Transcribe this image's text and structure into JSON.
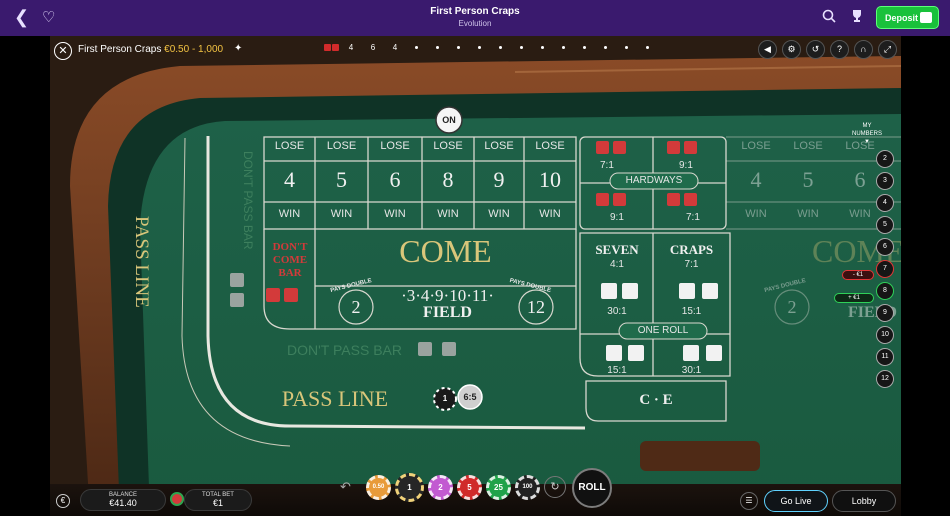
{
  "app": {
    "title": "First Person Craps",
    "provider": "Evolution",
    "deposit_label": "Deposit"
  },
  "hud": {
    "game_title": "First Person Craps",
    "limits": "€0.50 - 1,000",
    "history_numbers": [
      "4",
      "6",
      "4"
    ]
  },
  "table": {
    "on_puck": "ON",
    "lose_labels": [
      "LOSE",
      "LOSE",
      "LOSE",
      "LOSE",
      "LOSE",
      "LOSE"
    ],
    "place_numbers": [
      "4",
      "5",
      "6",
      "8",
      "9",
      "10"
    ],
    "win_labels": [
      "WIN",
      "WIN",
      "WIN",
      "WIN",
      "WIN",
      "WIN"
    ],
    "pass_line_vertical": "PASS LINE",
    "dont_pass_bar_vertical": "DON'T PASS BAR",
    "dont_come_bar": [
      "DON'T",
      "COME",
      "BAR"
    ],
    "come": "COME",
    "field_pays_double_left": "PAYS DOUBLE",
    "field_pays_double_right": "PAYS DOUBLE",
    "field_two": "2",
    "field_twelve": "12",
    "field_numbers": "·3·4·9·10·11·",
    "field": "FIELD",
    "dont_pass_bar": "DON'T PASS BAR",
    "pass_line": "PASS LINE",
    "hardways_label": "HARDWAYS",
    "hardway_odds": [
      "7:1",
      "9:1",
      "9:1",
      "7:1"
    ],
    "seven": "SEVEN",
    "seven_odds": "4:1",
    "craps": "CRAPS",
    "craps_odds": "7:1",
    "one_roll_left_odds": "30:1",
    "one_roll_right_odds": "15:1",
    "one_roll": "ONE ROLL",
    "bottom_left_odds": "15:1",
    "bottom_right_odds": "30:1",
    "ce": "C · E",
    "pass_chip": "1",
    "pass_odds_chip": "6:5",
    "ghost_lose_labels": [
      "LOSE",
      "LOSE",
      "LOSE"
    ],
    "ghost_numbers": [
      "4",
      "5",
      "6"
    ],
    "ghost_win_labels": [
      "WIN",
      "WIN",
      "WIN"
    ],
    "ghost_come": "COME",
    "ghost_pays_double": "PAYS DOUBLE",
    "ghost_two": "2",
    "ghost_field": "FIELD"
  },
  "my_numbers": {
    "title_line1": "MY",
    "title_line2": "NUMBERS",
    "numbers": [
      "2",
      "3",
      "4",
      "5",
      "6",
      "7",
      "8",
      "9",
      "10",
      "11",
      "12"
    ],
    "red_tag": "- €1",
    "green_tag": "+ €1"
  },
  "bottom": {
    "balance_label": "BALANCE",
    "balance_value": "€41.40",
    "total_bet_label": "TOTAL BET",
    "total_bet_value": "€1",
    "chips": [
      "0.50",
      "1",
      "2",
      "5",
      "25",
      "100"
    ],
    "roll_label": "ROLL",
    "go_live_label": "Go Live",
    "lobby_label": "Lobby"
  },
  "colors": {
    "felt": "#1f6b4b",
    "felt_dark": "#16563a",
    "rail_wood": "#6b3a1f",
    "text_gold": "#d9c67a",
    "accent_green": "#19c13b",
    "header_purple": "#3a1a6e"
  }
}
